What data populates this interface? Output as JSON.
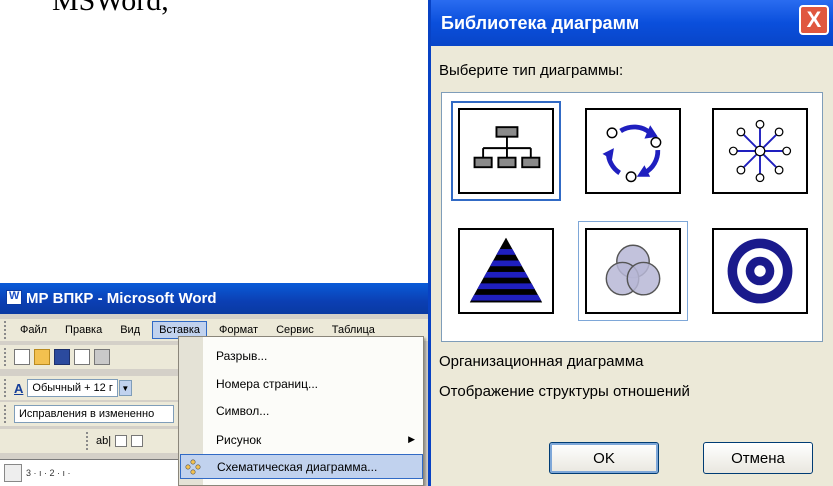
{
  "doc_text": "MSWord,",
  "word": {
    "title": "МР ВПКР - Microsoft Word",
    "menus": [
      "Файл",
      "Правка",
      "Вид",
      "Вставка",
      "Формат",
      "Сервис",
      "Таблица"
    ],
    "active_menu_index": 3,
    "style_value": "Обычный + 12 г",
    "style_letter": "A",
    "track_changes_value": "Исправления в измененно",
    "form_field_label": "ab|",
    "ruler_text": "3 · ı · 2 · ı ·"
  },
  "insert_menu": {
    "items": [
      {
        "label": "Разрыв..."
      },
      {
        "label": "Номера страниц..."
      },
      {
        "label": "Символ..."
      },
      {
        "label": "Рисунок",
        "submenu": true
      },
      {
        "label": "Схематическая диаграмма...",
        "highlighted": true
      }
    ]
  },
  "dialog": {
    "title": "Библиотека диаграмм",
    "prompt": "Выберите тип диаграммы:",
    "diagram_types": [
      {
        "icon": "org-chart-icon",
        "selected": true
      },
      {
        "icon": "cycle-diagram-icon"
      },
      {
        "icon": "radial-diagram-icon"
      },
      {
        "icon": "pyramid-diagram-icon"
      },
      {
        "icon": "venn-diagram-icon",
        "hovered": true
      },
      {
        "icon": "target-diagram-icon"
      }
    ],
    "selected_name": "Организационная диаграмма",
    "selected_description": "Отображение структуры отношений",
    "ok_label": "OK",
    "cancel_label": "Отмена",
    "close_label": "X"
  },
  "colors": {
    "titlebar": "#0a4fdc",
    "diagram_blue": "#1f1fbf",
    "selection": "#316ac5"
  }
}
